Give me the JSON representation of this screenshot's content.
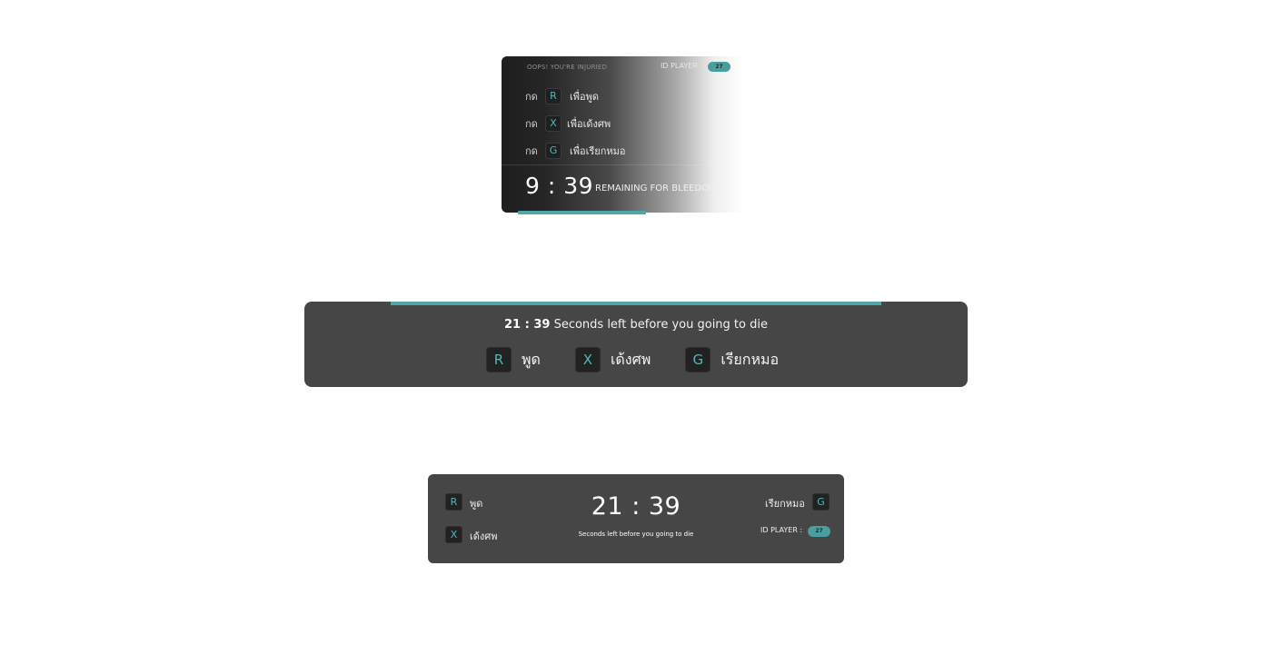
{
  "colors": {
    "accent": "#4fa7a7",
    "key_text": "#4fb8b8",
    "panel_bg": "#464646",
    "key_bg": "#222222"
  },
  "panel_injured": {
    "title": "OOPS! YOU'RE INJURIED",
    "id_label": "ID PLAYER",
    "id_value": "27",
    "press_label": "กด",
    "actions": [
      {
        "key": "R",
        "label": "เพื่อพูด"
      },
      {
        "key": "X",
        "label": "เพื่อเด้งศพ"
      },
      {
        "key": "G",
        "label": "เพื่อเรียกหมอ"
      }
    ],
    "timer": "9 : 39",
    "remaining_text": "REMAINING FOR BLEEDOUT"
  },
  "panel_center": {
    "timer": "21 : 39",
    "message": " Seconds left before you going to die",
    "actions": [
      {
        "key": "R",
        "label": "พูด"
      },
      {
        "key": "X",
        "label": "เด้งศพ"
      },
      {
        "key": "G",
        "label": "เรียกหมอ"
      }
    ]
  },
  "panel_bottom": {
    "actions_left": [
      {
        "key": "R",
        "label": "พูด"
      },
      {
        "key": "X",
        "label": "เด้งศพ"
      }
    ],
    "action_right": {
      "key": "G",
      "label": "เรียกหมอ"
    },
    "timer": "21 : 39",
    "sub_text": "Seconds left before you going to die",
    "id_label": "ID PLAYER :",
    "id_value": "27"
  }
}
